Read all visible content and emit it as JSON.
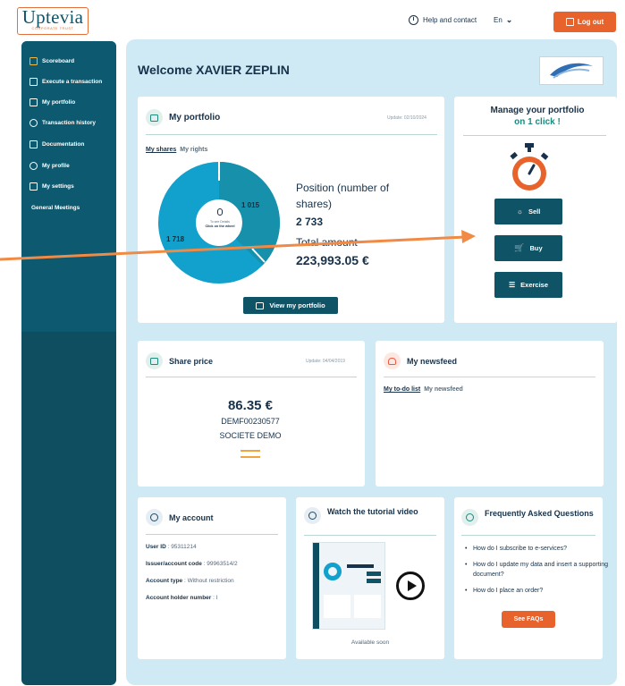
{
  "header": {
    "logo_name": "Uptevia",
    "logo_sub": "CORPORATE TRUST",
    "help_label": "Help and contact",
    "language": "En",
    "logout_label": "Log out"
  },
  "sidebar": {
    "items": [
      {
        "label": "Scoreboard",
        "icon": "scoreboard-icon"
      },
      {
        "label": "Execute a transaction",
        "icon": "transaction-icon"
      },
      {
        "label": "My portfolio",
        "icon": "portfolio-icon"
      },
      {
        "label": "Transaction history",
        "icon": "history-icon"
      },
      {
        "label": "Documentation",
        "icon": "documentation-icon"
      },
      {
        "label": "My profile",
        "icon": "profile-icon"
      },
      {
        "label": "My settings",
        "icon": "settings-icon"
      },
      {
        "label": "General Meetings",
        "icon": ""
      }
    ]
  },
  "main": {
    "welcome": "Welcome XAVIER ZEPLIN"
  },
  "portfolio": {
    "title": "My portfolio",
    "update": "Update: 02/10/2024",
    "tab_shares": "My shares",
    "tab_rights": "My rights",
    "donut_hint_1": "To see Details",
    "donut_hint_2": "Click on the wheel",
    "slice_large": "1 718",
    "slice_small": "1 015",
    "position_label": "Position (number of shares)",
    "position_value": "2 733",
    "total_label": "Total amount",
    "total_value": "223,993.05 €",
    "view_button": "View my portfolio"
  },
  "manage": {
    "title_1": "Manage your portfolio",
    "title_2": "on 1 click !",
    "sell": "Sell",
    "buy": "Buy",
    "exercise": "Exercise"
  },
  "share_price": {
    "title": "Share price",
    "update": "Update: 04/04/2019",
    "price": "86.35 €",
    "isin": "DEMF00230577",
    "company": "SOCIETE DEMO"
  },
  "newsfeed": {
    "title": "My newsfeed",
    "tab_todo": "My to-do list",
    "tab_news": "My newsfeed"
  },
  "account": {
    "title": "My account",
    "user_id_label": "User ID",
    "user_id_value": ": 95311214",
    "issuer_label": "Issuer/account code",
    "issuer_value": ": 99963514/2",
    "type_label": "Account type",
    "type_value": ": Without restriction",
    "holder_label": "Account holder number",
    "holder_value": ": I"
  },
  "tutorial": {
    "title": "Watch the tutorial video",
    "status": "Available soon"
  },
  "faq": {
    "title": "Frequently Asked Questions",
    "items": [
      "How do I subscribe to e-services?",
      "How do I update my data and insert a supporting document?",
      "How do I place an order?"
    ],
    "button": "See FAQs"
  },
  "colors": {
    "primary": "#0f5367",
    "accent": "#e8632c",
    "teal": "#1e8a7f",
    "background": "#cfeaf5"
  }
}
